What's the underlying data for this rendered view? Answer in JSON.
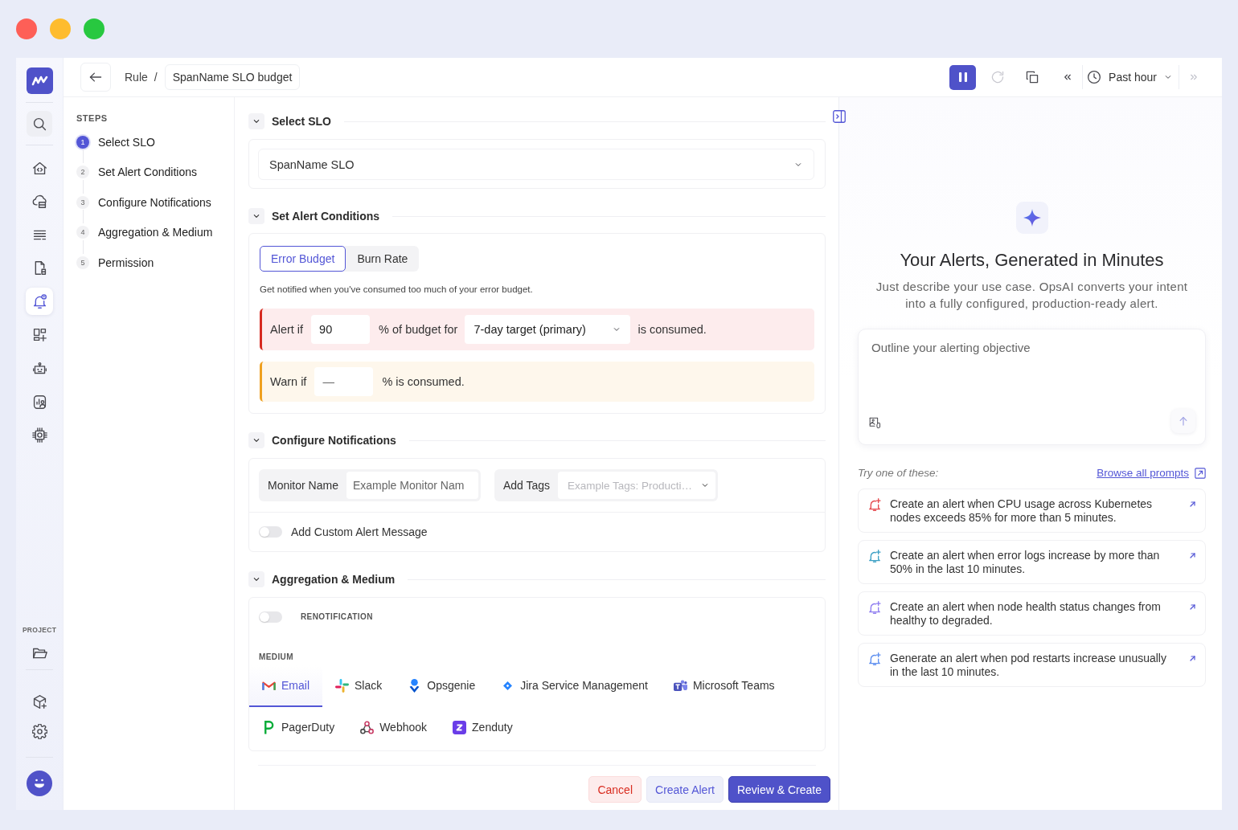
{
  "nav_rail": {
    "items": [
      {
        "selected": false
      },
      {
        "selected": false
      },
      {
        "selected": false
      },
      {
        "selected": false
      },
      {
        "selected": true
      },
      {
        "selected": false
      },
      {
        "selected": false
      },
      {
        "selected": false
      },
      {
        "selected": false
      }
    ],
    "project_label": "PROJECT",
    "project_items": [
      {
        "selected": false
      },
      {
        "selected": false
      },
      {
        "selected": false
      }
    ]
  },
  "header": {
    "breadcrumb": {
      "parent": "Rule",
      "separator": "/",
      "current": "SpanName SLO budget"
    },
    "time_range": "Past hour"
  },
  "steps": {
    "title": "STEPS",
    "items": [
      {
        "number": "1",
        "label": "Select SLO",
        "selected": true
      },
      {
        "number": "2",
        "label": "Set Alert Conditions",
        "selected": false
      },
      {
        "number": "3",
        "label": "Configure Notifications",
        "selected": false
      },
      {
        "number": "4",
        "label": "Aggregation & Medium",
        "selected": false
      },
      {
        "number": "5",
        "label": "Permission",
        "selected": false
      }
    ]
  },
  "select_slo": {
    "title": "Select SLO",
    "value": "SpanName SLO"
  },
  "alert_conditions": {
    "title": "Set Alert Conditions",
    "tabs": [
      {
        "label": "Error Budget",
        "selected": true
      },
      {
        "label": "Burn Rate",
        "selected": false
      }
    ],
    "description": "Get notified when you've consumed too much of your error budget.",
    "rules": [
      {
        "kind": "alert",
        "label": "Alert if",
        "value": "90",
        "middle": "% of budget for",
        "target": "7-day target (primary)",
        "suffix": "is consumed."
      },
      {
        "kind": "warn",
        "label": "Warn if",
        "placeholder": "—",
        "suffix": "% is consumed."
      }
    ]
  },
  "notifications": {
    "title": "Configure Notifications",
    "fields": [
      {
        "kind": "input",
        "label": "Monitor Name",
        "placeholder": "Example Monitor Nam"
      },
      {
        "kind": "select",
        "label": "Add Tags",
        "placeholder": "Example Tags: Producti…"
      }
    ],
    "custom_message": {
      "label": "Add Custom Alert Message",
      "on": false
    }
  },
  "aggregation": {
    "title": "Aggregation & Medium",
    "renotification": {
      "label": "RENOTIFICATION",
      "on": false
    },
    "medium_label": "MEDIUM",
    "media": [
      {
        "label": "Email",
        "selected": true
      },
      {
        "label": "Slack",
        "selected": false
      },
      {
        "label": "Opsgenie",
        "selected": false
      },
      {
        "label": "Jira Service Management",
        "selected": false
      },
      {
        "label": "Microsoft Teams",
        "selected": false
      },
      {
        "label": "PagerDuty",
        "selected": false
      },
      {
        "label": "Webhook",
        "selected": false
      },
      {
        "label": "Zenduty",
        "selected": false
      }
    ]
  },
  "footer": {
    "buttons": [
      {
        "kind": "danger",
        "label": "Cancel"
      },
      {
        "kind": "secondary",
        "label": "Create Alert"
      },
      {
        "kind": "primary",
        "label": "Review & Create"
      }
    ]
  },
  "assistant": {
    "title": "Your Alerts, Generated in Minutes",
    "subtitle": "Just describe your use case. OpsAI converts your intent into a fully configured, production-ready alert.",
    "prompt": {
      "placeholder": "Outline your alerting objective"
    },
    "suggestions_label": "Try one of these:",
    "browse_link": "Browse all prompts",
    "suggestions": [
      {
        "text": "Create an alert when CPU usage across Kubernetes nodes exceeds 85% for more than 5 minutes.",
        "color": "#e5484d"
      },
      {
        "text": "Create an alert when error logs increase by more than 50% in the last 10 minutes.",
        "color": "#3b9fc4"
      },
      {
        "text": "Create an alert when node health status changes from healthy to degraded.",
        "color": "#8e7cf0"
      },
      {
        "text": "Generate an alert when pod restarts increase unusually in the last 10 minutes.",
        "color": "#5b8def"
      }
    ]
  }
}
